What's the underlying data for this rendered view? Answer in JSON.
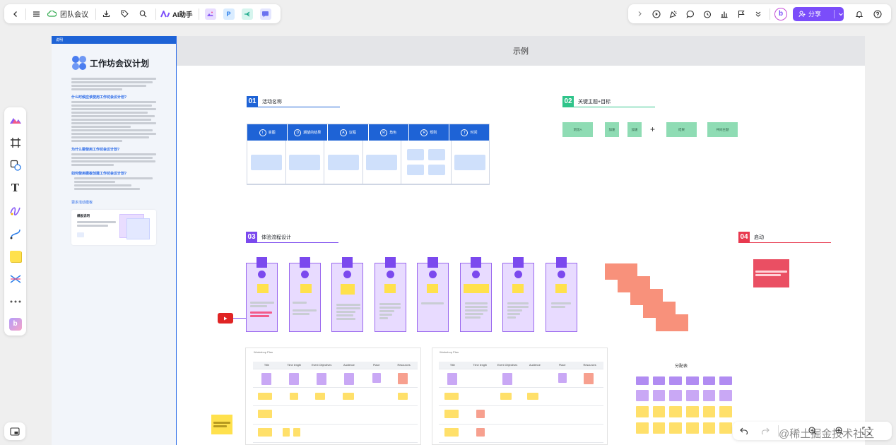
{
  "toolbar_left": {
    "back_icon": "chevron-left-icon",
    "menu_icon": "hamburger-icon",
    "cloud_icon": "cloud-icon",
    "doc_title": "团队会议",
    "download_icon": "download-icon",
    "tag_icon": "tag-icon",
    "search_icon": "search-icon",
    "ai_label": "AI助手",
    "app_icons": [
      "image-app-icon",
      "p-app-icon",
      "mindmap-app-icon",
      "chat-app-icon"
    ]
  },
  "toolbar_right": {
    "expand_icon": "chevron-right-icon",
    "play_icon": "play-icon",
    "celebrate_icon": "party-icon",
    "comment_icon": "comment-icon",
    "timer_icon": "timer-icon",
    "chart_icon": "chart-icon",
    "flag_icon": "flag-icon",
    "more_icon": "double-chevron-down-icon",
    "share_label": "分享",
    "bell_icon": "bell-icon",
    "help_icon": "help-icon"
  },
  "left_tools": [
    "templates-icon",
    "frame-icon",
    "shapes-icon",
    "text-icon",
    "pen-icon",
    "connector-icon",
    "sticky-note-icon",
    "mindmap-icon",
    "more-icon",
    "plugin-icon"
  ],
  "bottom_left_icon": "minimap-icon",
  "guide_panel": {
    "tab": "说明",
    "title": "工作坊会议计划",
    "sections": [
      "什么时候应该使用工作坊会议计划?",
      "为什么要使用工作坊会议计划?",
      "如何使用模板创建工作坊会议计划?"
    ],
    "more_link": "更多活动模板",
    "card_title": "模板说明"
  },
  "board": {
    "title": "示例",
    "section01": {
      "num": "01",
      "title": "活动名称"
    },
    "section02": {
      "num": "02",
      "title": "关键主题+目标"
    },
    "section03": {
      "num": "03",
      "title": "体验流程设计"
    },
    "section04": {
      "num": "04",
      "title": "启动"
    },
    "irarrt": [
      {
        "letter": "I",
        "label": "意图"
      },
      {
        "letter": "D",
        "label": "期望的结果"
      },
      {
        "letter": "A",
        "label": "议程"
      },
      {
        "letter": "R",
        "label": "角色"
      },
      {
        "letter": "R",
        "label": "规则"
      },
      {
        "letter": "T",
        "label": "时间"
      }
    ],
    "goal_cards": [
      "洞见A",
      "加速",
      "加速",
      "结果",
      "共同主题"
    ],
    "goal_plus": "+",
    "launch_note": "关键事项和通知环节中的内容...",
    "process_label": "分配表",
    "template_a": "Workshop Plan",
    "template_b": "Workshop Plan",
    "columns": [
      "Title",
      "Time length",
      "Event Objectives",
      "Audience",
      "Place",
      "Resources"
    ],
    "columns_b": [
      "Title",
      "Time length",
      "Event Objectives",
      "Audience",
      "Place",
      "Resources"
    ]
  },
  "bottom_right": {
    "undo_icon": "undo-icon",
    "redo_icon": "redo-icon",
    "zoom_out_icon": "zoom-out-icon",
    "zoom_in_icon": "zoom-in-icon",
    "fit_icon": "fit-icon"
  },
  "watermark": "@稀土掘金技术社区",
  "colors": {
    "accent": "#7b4dfa",
    "blue": "#1e63d6",
    "purple": "#7b49ee",
    "green": "#2fc48a",
    "red": "#e8394f",
    "salmon": "#f8917b"
  }
}
